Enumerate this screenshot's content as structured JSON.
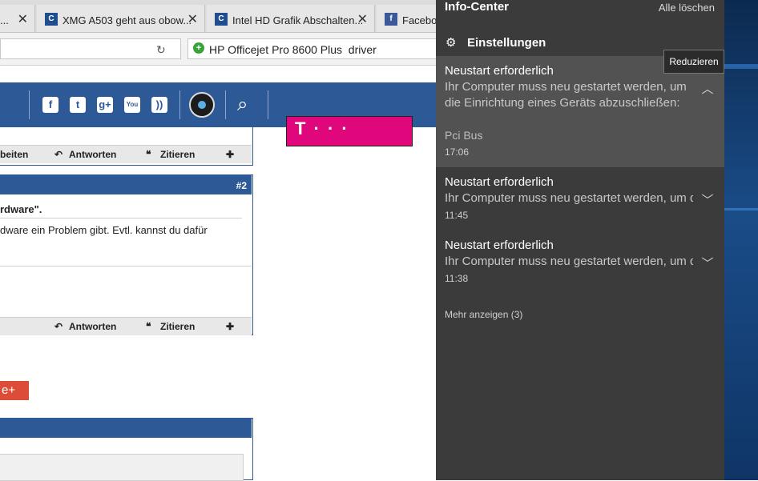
{
  "browser": {
    "tabs": [
      {
        "label": "...",
        "favicon": "page-icon"
      },
      {
        "label": "XMG A503 geht aus obow...",
        "favicon": "cb-icon"
      },
      {
        "label": "Intel HD Grafik Abschalten...",
        "favicon": "cb-icon"
      },
      {
        "label": "Faceboo",
        "favicon": "facebook-icon"
      }
    ],
    "search": {
      "query": "HP Officejet Pro 8600 Plus  driver"
    }
  },
  "page": {
    "post1_actions": {
      "edit": "beiten",
      "reply": "Antworten",
      "quote": "Zitieren"
    },
    "post2": {
      "number": "#2",
      "line1": "rdware\".",
      "line2": "dware ein Problem gibt. Evtl. kannst du dafür"
    },
    "post2_actions": {
      "reply": "Antworten",
      "quote": "Zitieren"
    },
    "gplus_label": "e+",
    "ad_logo": "T · · ·"
  },
  "info_center": {
    "title": "Info-Center",
    "clear_all": "Alle löschen",
    "settings": "Einstellungen",
    "tooltip": "Reduzieren",
    "notifications": [
      {
        "title": "Neustart erforderlich",
        "body_line1": "Ihr Computer muss neu gestartet werden, um",
        "body_line2": "die Einrichtung eines Geräts abzuschließen:",
        "source": "Pci Bus",
        "time": "17:06",
        "expanded": true
      },
      {
        "title": "Neustart erforderlich",
        "body_line1": "Ihr Computer muss neu gestartet werden, um d",
        "time": "11:45",
        "expanded": false
      },
      {
        "title": "Neustart erforderlich",
        "body_line1": "Ihr Computer muss neu gestartet werden, um d",
        "time": "11:38",
        "expanded": false
      }
    ],
    "show_more": "Mehr anzeigen (3)"
  },
  "colors": {
    "panel_bg": "#3b3b3b",
    "expanded_bg": "#525252",
    "forum_blue": "#2d5a96",
    "ad_magenta": "#e0077d",
    "gplus_red": "#dd4b39"
  }
}
